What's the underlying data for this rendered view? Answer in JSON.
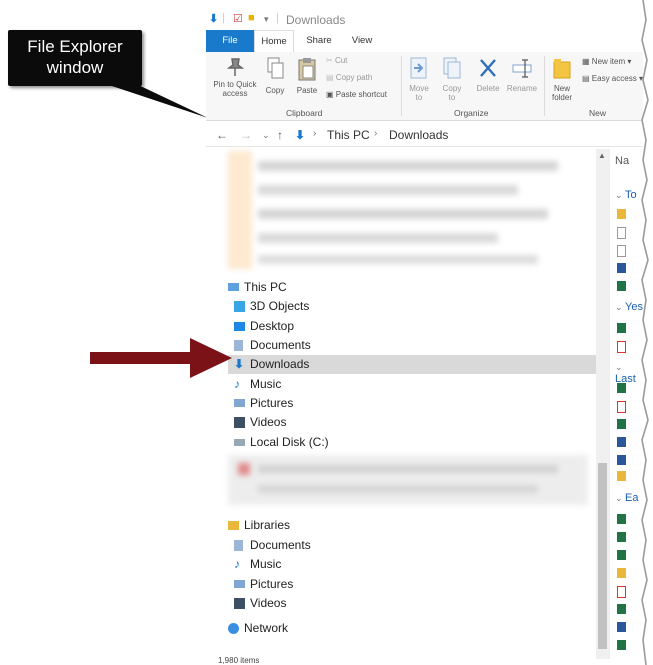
{
  "callout": {
    "line1": "File Explorer",
    "line2": "window"
  },
  "window": {
    "title": "Downloads",
    "tabs": {
      "file": "File",
      "home": "Home",
      "share": "Share",
      "view": "View"
    },
    "ribbon": {
      "clipboard": {
        "pin_line1": "Pin to Quick",
        "pin_line2": "access",
        "copy": "Copy",
        "paste": "Paste",
        "cut": "Cut",
        "copy_path": "Copy path",
        "paste_shortcut": "Paste shortcut",
        "label": "Clipboard"
      },
      "organize": {
        "move_line1": "Move",
        "move_line2": "to",
        "copy_line1": "Copy",
        "copy_line2": "to",
        "delete": "Delete",
        "rename": "Rename",
        "label": "Organize"
      },
      "new": {
        "new_folder_line1": "New",
        "new_folder_line2": "folder",
        "new_item": "New item",
        "easy_access": "Easy access",
        "label": "New"
      }
    },
    "address": {
      "root": "This PC",
      "current": "Downloads"
    },
    "nav": {
      "this_pc": "This PC",
      "pc_items": [
        "3D Objects",
        "Desktop",
        "Documents",
        "Downloads",
        "Music",
        "Pictures",
        "Videos",
        "Local Disk (C:)"
      ],
      "libraries": "Libraries",
      "lib_items": [
        "Documents",
        "Music",
        "Pictures",
        "Videos"
      ],
      "network": "Network"
    },
    "content": {
      "header": "Na",
      "groups": [
        "To",
        "Yes",
        "Last",
        "Ea"
      ]
    },
    "status": "1,980 items"
  },
  "colors": {
    "accent": "#1979ca",
    "arrow": "#7a1217",
    "callout_bg": "#0b0b0b",
    "selection": "#d9d9d9"
  }
}
